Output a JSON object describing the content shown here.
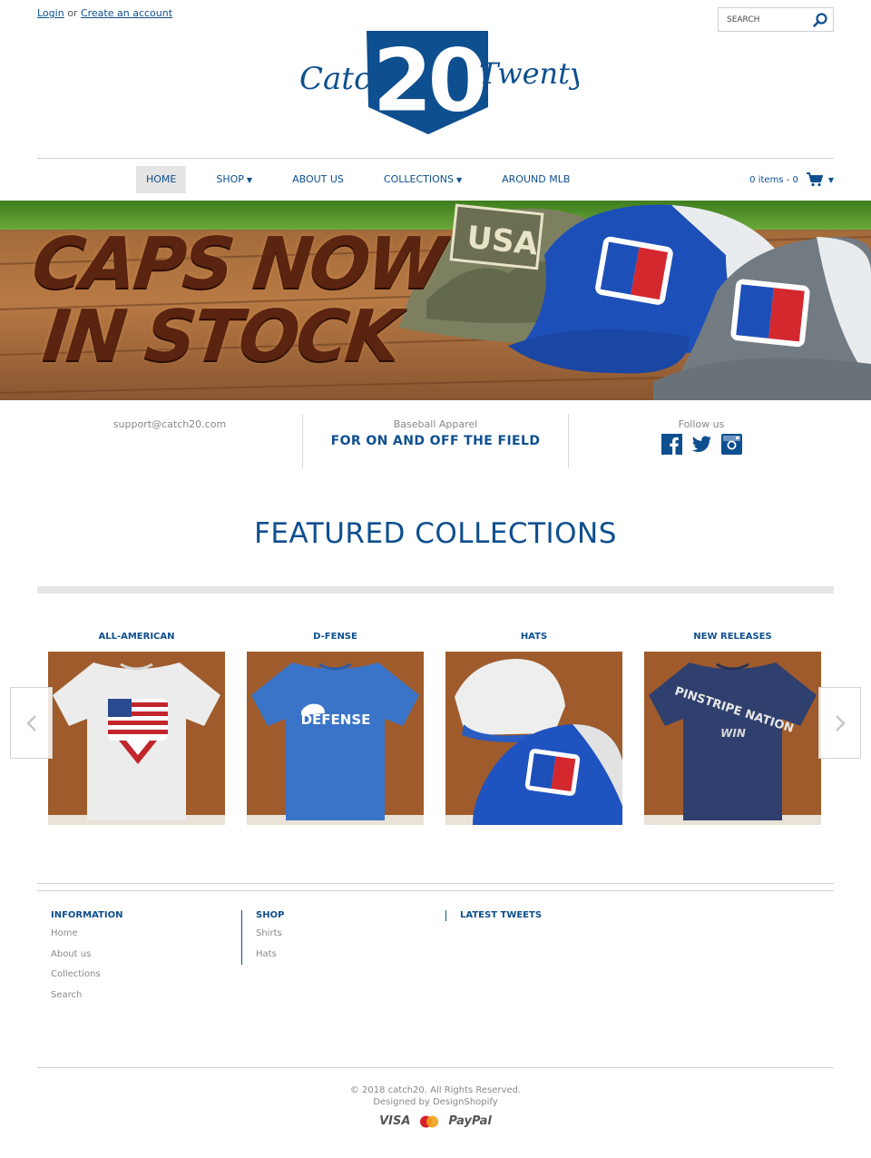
{
  "header": {
    "login_label": "Login",
    "or_text": "or",
    "create_account_label": "Create an account",
    "search_placeholder": "SEARCH",
    "logo_text_left": "Catch",
    "logo_text_number": "20",
    "logo_text_right": "Twenty"
  },
  "nav": {
    "items": [
      {
        "label": "HOME",
        "active": true
      },
      {
        "label": "SHOP",
        "dropdown": true
      },
      {
        "label": "ABOUT US"
      },
      {
        "label": "COLLECTIONS",
        "dropdown": true
      },
      {
        "label": "AROUND MLB"
      }
    ],
    "cart_label": "0 items - 0"
  },
  "banner": {
    "line1": "CAPS NOW",
    "line2": "IN STOCK",
    "hat_patch": "USA"
  },
  "info": {
    "email": "support@catch20.com",
    "tagline_small": "Baseball Apparel",
    "tagline_big": "FOR ON AND OFF THE FIELD",
    "follow_label": "Follow us",
    "social_icons": [
      "facebook-icon",
      "twitter-icon",
      "instagram-icon"
    ]
  },
  "featured": {
    "title": "FEATURED COLLECTIONS",
    "collections": [
      {
        "title": "ALL-AMERICAN"
      },
      {
        "title": "D-FENSE",
        "shirt_text": "DEFENSE"
      },
      {
        "title": "HATS"
      },
      {
        "title": "NEW RELEASES",
        "shirt_text": "PINSTRIPE NATION",
        "shirt_subtext": "WIN"
      }
    ]
  },
  "footer": {
    "information": {
      "heading": "INFORMATION",
      "links": [
        "Home",
        "About us",
        "Collections",
        "Search"
      ]
    },
    "shop": {
      "heading": "SHOP",
      "links": [
        "Shirts",
        "Hats"
      ]
    },
    "tweets_heading": "LATEST TWEETS",
    "copyright": "© 2018 catch20. All Rights Reserved.",
    "designed_by": "Designed by DesignShopify",
    "payments": [
      "VISA",
      "PayPal"
    ]
  },
  "colors": {
    "brand_blue": "#0e4f8f",
    "text_grey": "#888888"
  }
}
